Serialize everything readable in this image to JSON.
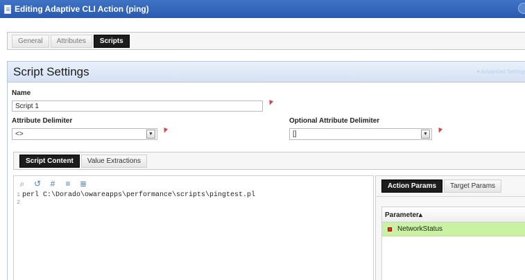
{
  "window": {
    "title": "Editing Adaptive CLI Action (ping)"
  },
  "top_tabs": [
    {
      "label": "General",
      "active": false
    },
    {
      "label": "Attributes",
      "active": false
    },
    {
      "label": "Scripts",
      "active": true
    }
  ],
  "panel": {
    "title": "Script Settings",
    "hint": "▾ Advanced Settings"
  },
  "fields": {
    "name_label": "Name",
    "name_value": "Script 1",
    "attr_delim_label": "Attribute Delimiter",
    "attr_delim_value": "<>",
    "opt_attr_delim_label": "Optional Attribute Delimiter",
    "opt_attr_delim_value": "[]"
  },
  "inner_tabs": [
    {
      "label": "Script Content",
      "active": true
    },
    {
      "label": "Value Extractions",
      "active": false
    }
  ],
  "toolbar_icons": [
    "search-icon",
    "undo-icon",
    "hash-icon",
    "format-icon",
    "indent-icon"
  ],
  "toolbar_glyphs": {
    "search": "⌕",
    "undo": "↺",
    "hash": "#",
    "format": "≡",
    "indent": "≣"
  },
  "editor": {
    "lines": [
      {
        "num": "1",
        "text": "perl C:\\Dorado\\owareapps\\performance\\scripts\\pingtest.pl"
      },
      {
        "num": "2",
        "text": ""
      }
    ]
  },
  "params_tabs": [
    {
      "label": "Action Params",
      "active": true
    },
    {
      "label": "Target Params",
      "active": false
    }
  ],
  "params_grid": {
    "header": "Parameter▴",
    "rows": [
      {
        "name": "NetworkStatus",
        "status_color": "#e03030"
      }
    ]
  },
  "colors": {
    "accent": "#2a5ab0",
    "selected_row": "#c9f2a3",
    "required": "#dd4444"
  }
}
